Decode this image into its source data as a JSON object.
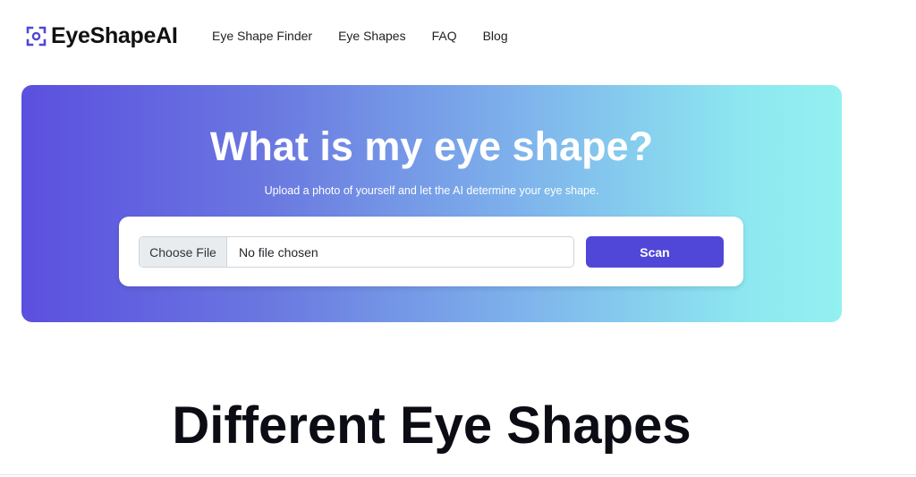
{
  "brand": {
    "name": "EyeShapeAI",
    "icon": "eye-scan-icon",
    "accent_color": "#5046d8"
  },
  "nav": {
    "items": [
      {
        "label": "Eye Shape Finder"
      },
      {
        "label": "Eye Shapes"
      },
      {
        "label": "FAQ"
      },
      {
        "label": "Blog"
      }
    ]
  },
  "hero": {
    "title": "What is my eye shape?",
    "subtitle": "Upload a photo of yourself and let the AI determine your eye shape.",
    "gradient_start": "#5b4fdf",
    "gradient_end": "#93f0f0"
  },
  "upload": {
    "choose_file_label": "Choose File",
    "file_status": "No file chosen",
    "scan_label": "Scan",
    "scan_color": "#5046d8"
  },
  "section": {
    "heading": "Different Eye Shapes"
  }
}
